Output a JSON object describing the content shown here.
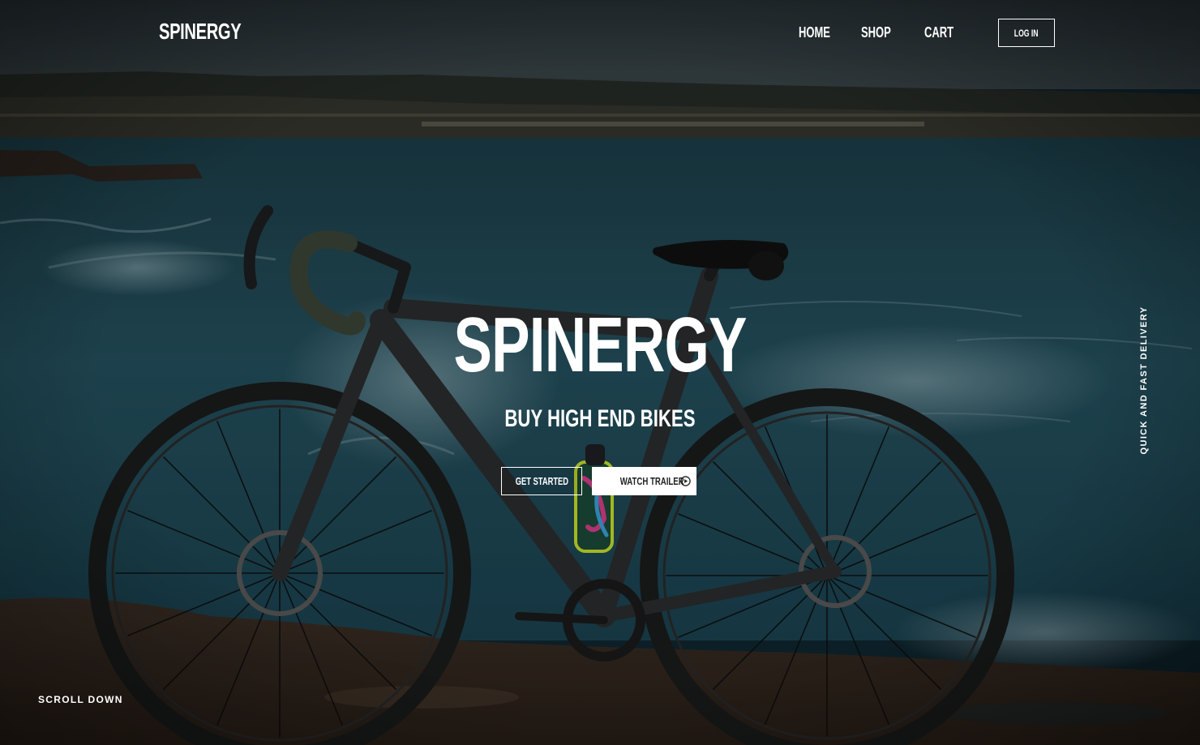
{
  "brand": {
    "logo": "SPINERGY"
  },
  "nav": {
    "items": [
      {
        "label": "HOME"
      },
      {
        "label": "SHOP"
      },
      {
        "label": "CART"
      }
    ],
    "login_label": "LOG IN"
  },
  "hero": {
    "title": "SPINERGY",
    "subtitle": "BUY HIGH END BIKES",
    "primary_cta": "GET STARTED",
    "secondary_cta": "WATCH TRAILER",
    "secondary_cta_icon": "play-circle-icon",
    "background": "bike-on-rocky-coast-photo"
  },
  "side_label": "QUICK AND FAST DELIVERY",
  "scroll_label": "SCROLL DOWN",
  "colors": {
    "text": "#ffffff",
    "water": "#1f4a57",
    "sky": "#2c373c",
    "rock": "#3b2c20",
    "button_fill": "#ffffff",
    "button_text": "#222222"
  }
}
